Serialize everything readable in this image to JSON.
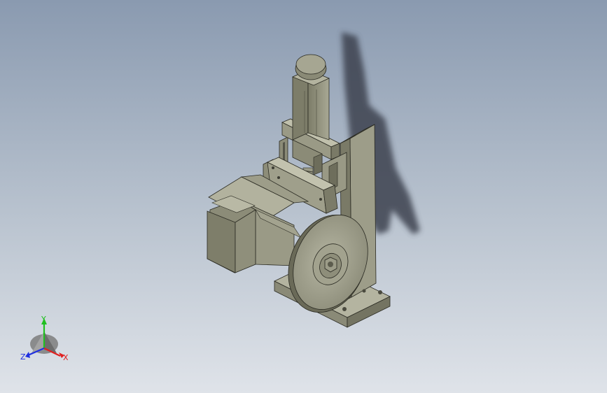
{
  "triad": {
    "x_label": "X",
    "y_label": "Y",
    "z_label": "Z"
  },
  "colors": {
    "background_top": "#8a9ab0",
    "background_bottom": "#dfe3e9",
    "model_light": "#a9a995",
    "model_mid": "#8f8f7b",
    "model_dark": "#6f6f5e",
    "shadow": "#3e4350",
    "x_axis": "#e02020",
    "y_axis": "#20c020",
    "z_axis": "#2030e0"
  }
}
